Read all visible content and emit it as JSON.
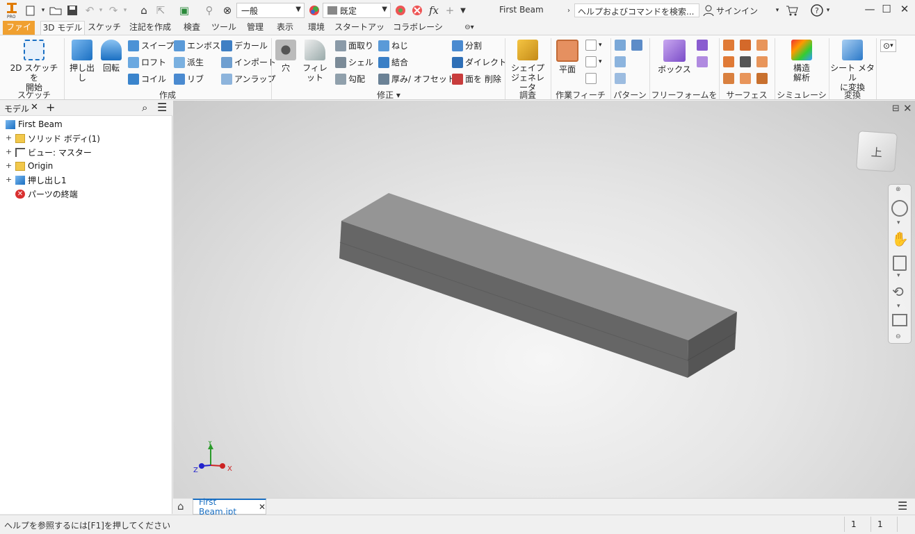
{
  "window": {
    "title": "First Beam",
    "help_placeholder": "ヘルプおよびコマンドを検索...",
    "sign_in": "サインイン"
  },
  "quick_access": {
    "material_value": "一般",
    "appearance_value": "既定"
  },
  "tabs": [
    {
      "label": "ファイル"
    },
    {
      "label": "3D モデル"
    },
    {
      "label": "スケッチ"
    },
    {
      "label": "注記を作成"
    },
    {
      "label": "検査"
    },
    {
      "label": "ツール"
    },
    {
      "label": "管理"
    },
    {
      "label": "表示"
    },
    {
      "label": "環境"
    },
    {
      "label": "スタートアップ"
    },
    {
      "label": "コラボレーション"
    }
  ],
  "ribbon": {
    "sketch": {
      "start": "2D スケッチを\n開始",
      "group": "スケッチ"
    },
    "create": {
      "extrude": "押し出し",
      "revolve": "回転",
      "sweep": "スイープ",
      "loft": "ロフト",
      "coil": "コイル",
      "emboss": "エンボス",
      "derive": "派生",
      "rib": "リブ",
      "decal": "デカール",
      "import": "インポート",
      "unwrap": "アンラップ",
      "group": "作成"
    },
    "modify": {
      "hole": "穴",
      "fillet": "フィレット",
      "chamfer": "面取り",
      "shell": "シェル",
      "draft": "勾配",
      "thread": "ねじ",
      "combine": "結合",
      "thicken": "厚み/ オフセット",
      "split": "分割",
      "direct": "ダイレクト",
      "delete_face": "面を 削除",
      "group": "修正 ▾"
    },
    "explore": {
      "shape_gen": "シェイプ\nジェネレータ",
      "group": "調査"
    },
    "work": {
      "plane": "平面",
      "group": "作業フィーチャ"
    },
    "pattern": {
      "group": "パターン"
    },
    "freeform": {
      "box": "ボックス",
      "group": "フリーフォームを作成"
    },
    "surface": {
      "group": "サーフェス"
    },
    "simulation": {
      "stress": "構造\n解析",
      "group": "シミュレーション"
    },
    "convert": {
      "sheet_metal": "シート メタル\nに変換",
      "group": "変換"
    }
  },
  "browser": {
    "tab_label": "モデル",
    "tree": [
      {
        "label": "First Beam"
      },
      {
        "label": "ソリッド ボディ(1)"
      },
      {
        "label": "ビュー: マスター"
      },
      {
        "label": "Origin"
      },
      {
        "label": "押し出し1"
      },
      {
        "label": "パーツの終端"
      }
    ]
  },
  "viewcube": {
    "face": "上"
  },
  "triad": {
    "x": "X",
    "y": "Y",
    "z": "Z"
  },
  "doc_tab": {
    "label": "First Beam.ipt"
  },
  "status": {
    "help": "ヘルプを参照するには[F1]を押してください",
    "count1": "1",
    "count2": "1"
  },
  "colors": {
    "file_tab": "#f0a030",
    "accent_blue": "#1a6fc2",
    "beam_top": "#959595",
    "beam_front": "#636363",
    "beam_end": "#555555"
  }
}
